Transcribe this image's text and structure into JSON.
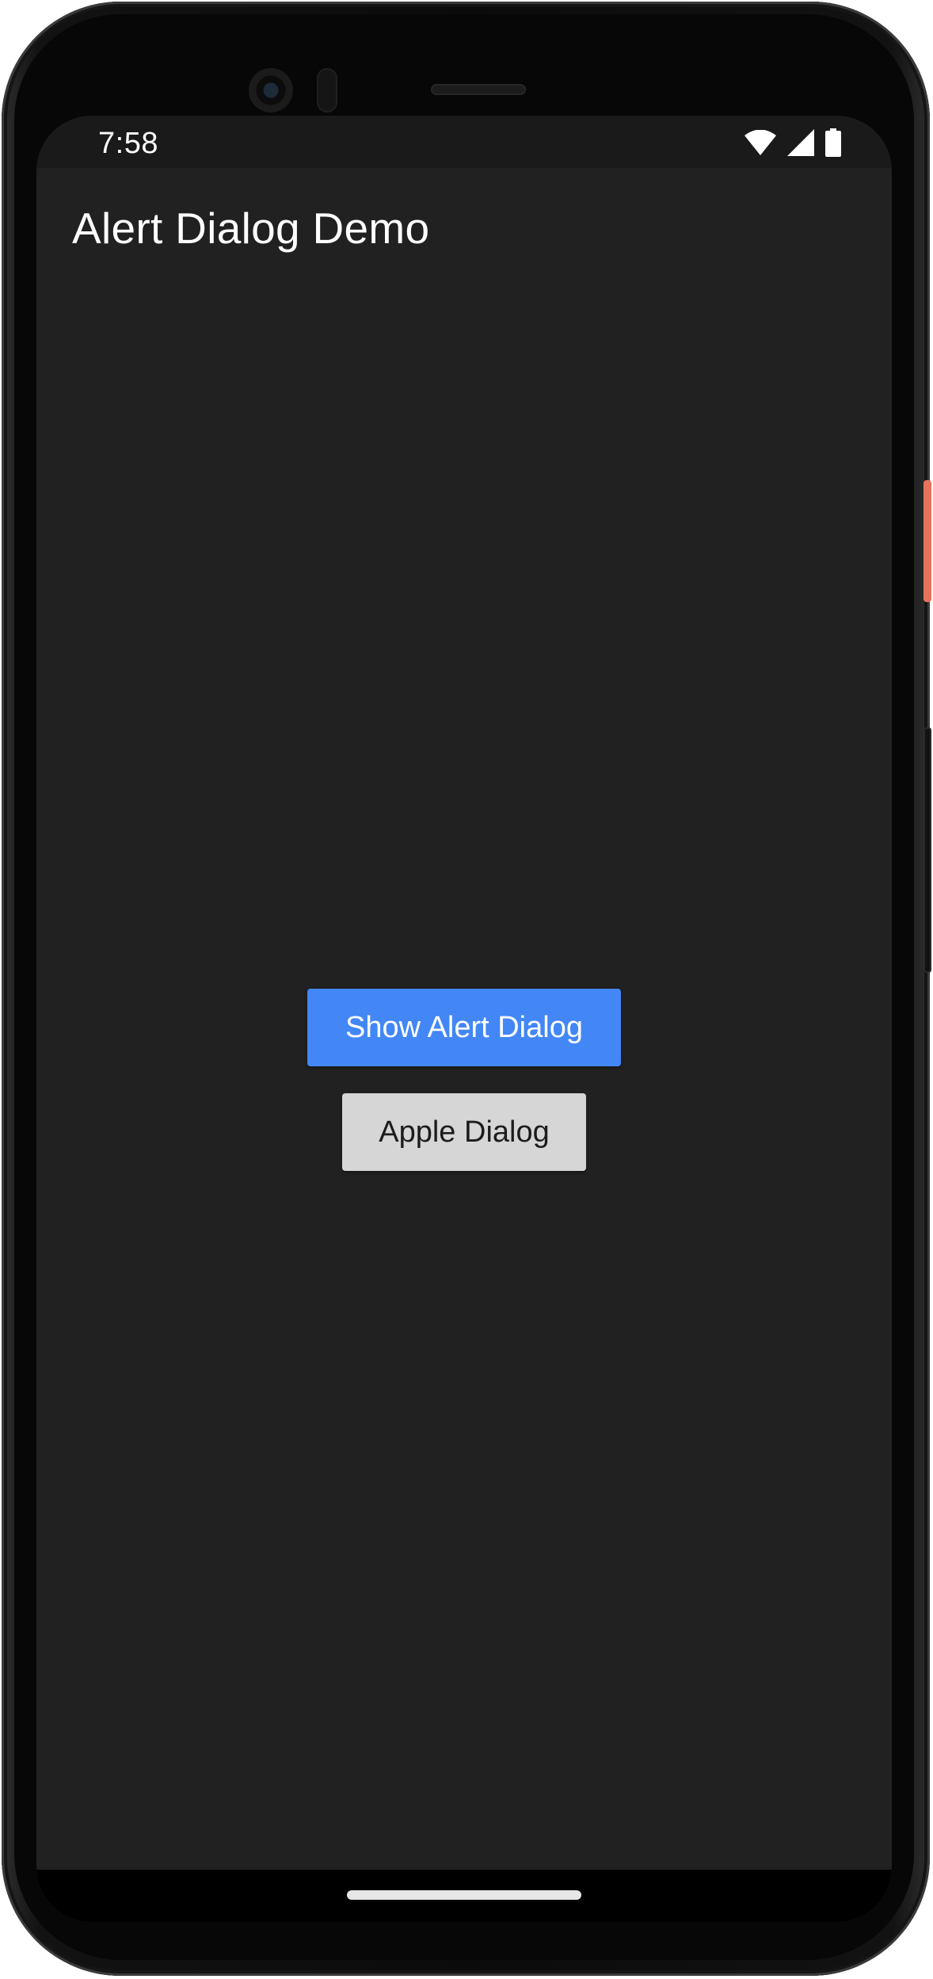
{
  "status_bar": {
    "time": "7:58",
    "icons": [
      "wifi-icon",
      "cellular-signal-icon",
      "battery-icon"
    ]
  },
  "app_bar": {
    "title": "Alert Dialog Demo"
  },
  "buttons": {
    "show_alert_label": "Show Alert Dialog",
    "apple_dialog_label": "Apple Dialog"
  },
  "colors": {
    "background": "#212121",
    "primary_button": "#4287f5",
    "secondary_button": "#d6d6d6",
    "accent_power_key": "#e7735a"
  }
}
